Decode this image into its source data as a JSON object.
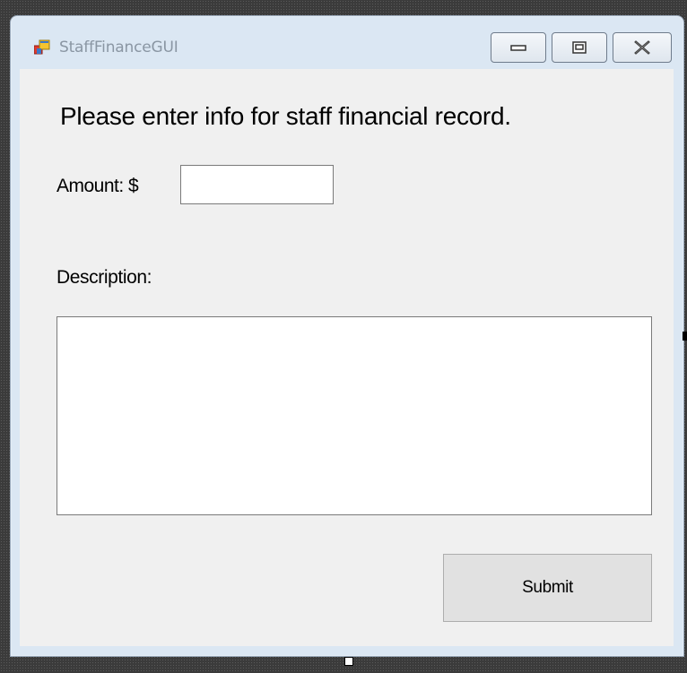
{
  "window": {
    "title": "StaffFinanceGUI",
    "icons": {
      "app": "form-icon",
      "minimize": "minimize-icon",
      "maximize": "maximize-icon",
      "close": "close-icon"
    }
  },
  "form": {
    "heading": "Please enter info for staff financial record.",
    "amount_label": "Amount: $",
    "amount_value": "",
    "description_label": "Description:",
    "description_value": "",
    "submit_label": "Submit"
  },
  "colors": {
    "client_background": "#f0f0f0",
    "frame": "#dbe7f3",
    "button_face": "#e1e1e1"
  }
}
